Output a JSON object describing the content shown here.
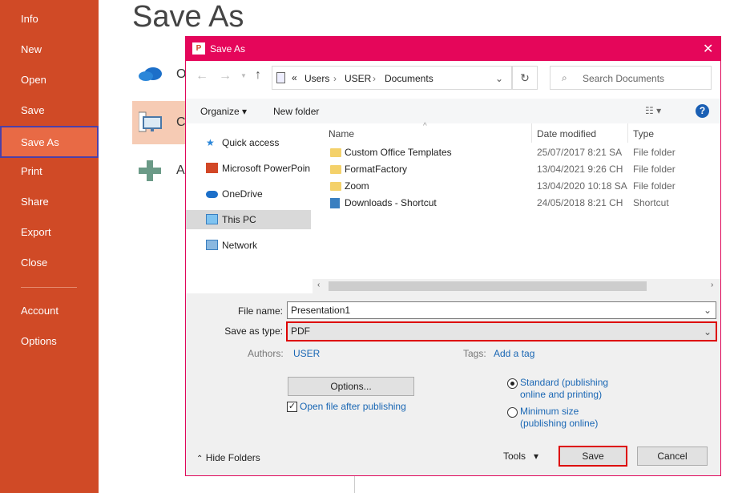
{
  "backstage": {
    "nav": [
      {
        "label": "Info"
      },
      {
        "label": "New"
      },
      {
        "label": "Open"
      },
      {
        "label": "Save"
      },
      {
        "label": "Save As",
        "selected": true
      },
      {
        "label": "Print"
      },
      {
        "label": "Share"
      },
      {
        "label": "Export"
      },
      {
        "label": "Close"
      },
      {
        "label": "Account"
      },
      {
        "label": "Options"
      }
    ],
    "title": "Save As",
    "locations": [
      {
        "label": "O",
        "icon": "onedrive-cloud-icon"
      },
      {
        "label": "C",
        "icon": "computer-icon",
        "selected": true
      },
      {
        "label": "A",
        "icon": "add-place-icon"
      }
    ]
  },
  "dialog": {
    "title": "Save As",
    "breadcrumb": {
      "prefix": "«",
      "parts": [
        "Users",
        "USER",
        "Documents"
      ]
    },
    "search_placeholder": "Search Documents",
    "toolbar": {
      "organize": "Organize",
      "new_folder": "New folder"
    },
    "tree": [
      {
        "label": "Quick access"
      },
      {
        "label": "Microsoft PowerPoin"
      },
      {
        "label": "OneDrive"
      },
      {
        "label": "This PC",
        "selected": true
      },
      {
        "label": "Network"
      }
    ],
    "columns": {
      "name": "Name",
      "date": "Date modified",
      "type": "Type"
    },
    "files": [
      {
        "name": "Custom Office Templates",
        "date": "25/07/2017 8:21 SA",
        "type": "File folder",
        "icon": "folder-icon"
      },
      {
        "name": "FormatFactory",
        "date": "13/04/2021 9:26 CH",
        "type": "File folder",
        "icon": "folder-icon"
      },
      {
        "name": "Zoom",
        "date": "13/04/2020 10:18 SA",
        "type": "File folder",
        "icon": "folder-icon"
      },
      {
        "name": "Downloads - Shortcut",
        "date": "24/05/2018 8:21 CH",
        "type": "Shortcut",
        "icon": "shortcut-icon"
      }
    ],
    "file_name_label": "File name:",
    "file_name": "Presentation1",
    "save_type_label": "Save as type:",
    "save_type": "PDF",
    "authors_label": "Authors:",
    "authors": "USER",
    "tags_label": "Tags:",
    "tags": "Add a tag",
    "options_button": "Options...",
    "open_after": {
      "label": "Open file after publishing",
      "checked": true
    },
    "optimize": [
      {
        "label": "Standard (publishing online and printing)",
        "line1": "Standard (publishing",
        "line2": "online and printing)",
        "selected": true
      },
      {
        "label": "Minimum size (publishing online)",
        "line1": "Minimum size",
        "line2": "(publishing online)",
        "selected": false
      }
    ],
    "hide_folders": "Hide Folders",
    "tools": "Tools",
    "save": "Save",
    "cancel": "Cancel"
  },
  "colors": {
    "sidebar": "#d04a26",
    "titlebar": "#e5065a",
    "highlight": "#dd0000"
  }
}
